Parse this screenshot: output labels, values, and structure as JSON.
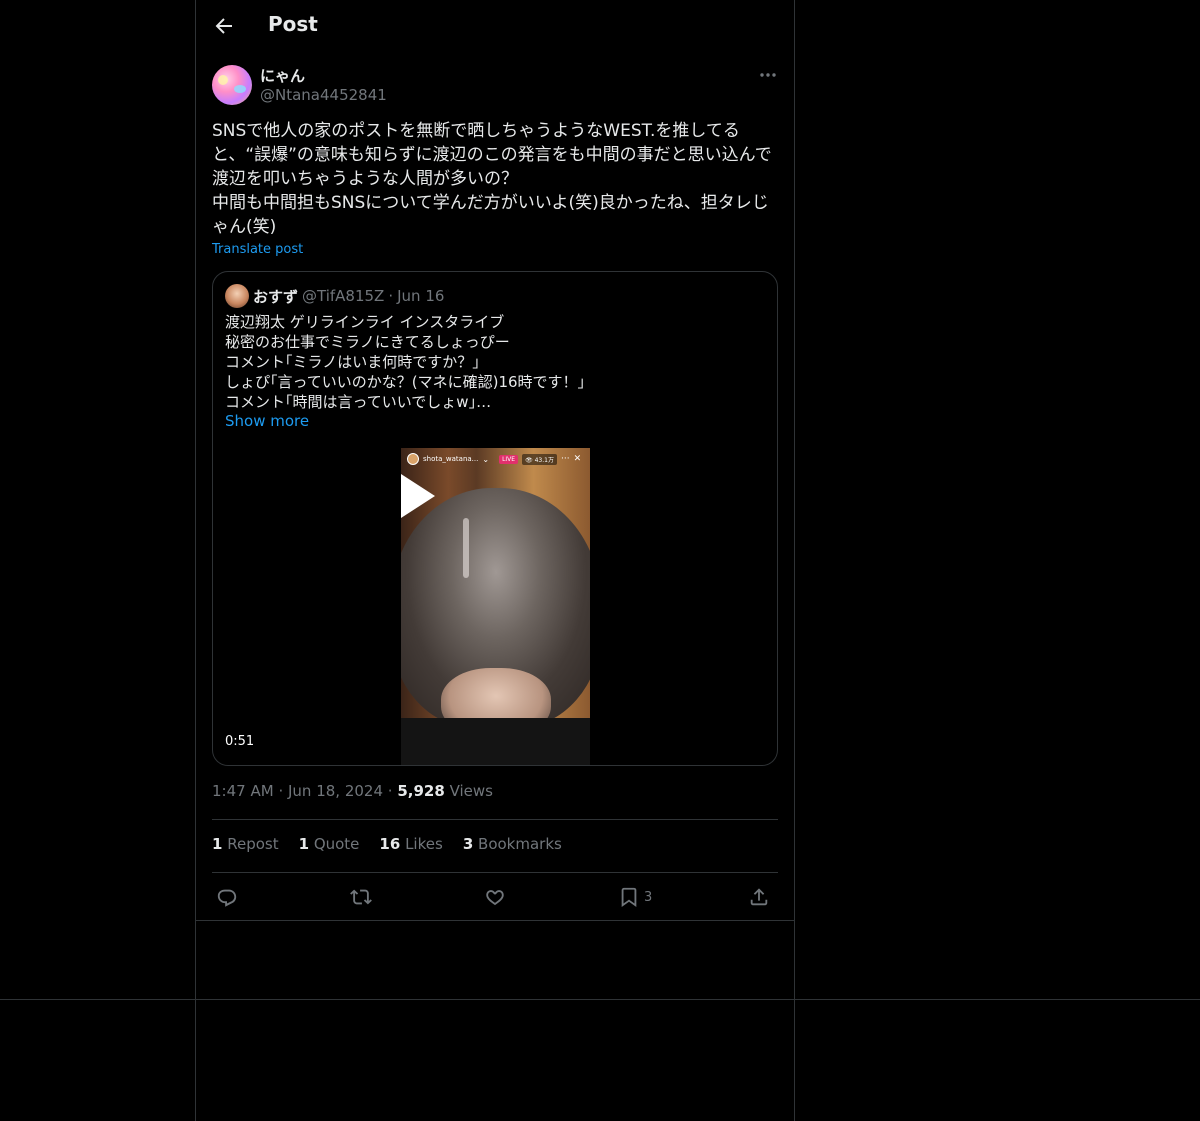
{
  "header": {
    "title": "Post"
  },
  "post": {
    "author_name": "にゃん",
    "author_handle": "@Ntana4452841",
    "text": "SNSで他人の家のポストを無断で晒しちゃうようなWEST.を推してる\nと、“誤爆”の意味も知らずに渡辺のこの発言をも中間の事だと思い込んで\n渡辺を叩いちゃうような人間が多いの？\n中間も中間担もSNSについて学んだ方がいいよ(笑)良かったね、担タレじ\nゃん(笑)",
    "translate_label": "Translate post",
    "time": "1:47 AM",
    "date": "Jun 18, 2024",
    "views_count": "5,928",
    "views_label": "Views"
  },
  "quote": {
    "name": "おすず",
    "handle": "@TifA815Z",
    "separator": "·",
    "date": "Jun 16",
    "text": "渡辺翔太 ゲリラインライ インスタライブ\n秘密のお仕事でミラノにきてるしょっぴー\nコメント｢ミラノはいま何時ですか？｣\nしょぴ｢言っていいのかな？(マネに確認)16時です！｣\nコメント｢時間は言っていいでしょw｣…",
    "show_more": "Show more",
    "video": {
      "duration": "0:51",
      "ig_name": "shota_watana...",
      "live_badge": "LIVE",
      "viewers": "👁 43.1万"
    }
  },
  "stats": {
    "reposts_count": "1",
    "reposts_label": "Repost",
    "quotes_count": "1",
    "quotes_label": "Quote",
    "likes_count": "16",
    "likes_label": "Likes",
    "bookmarks_count": "3",
    "bookmarks_label": "Bookmarks"
  },
  "actions": {
    "bookmark_count": "3",
    "icons": [
      "reply-icon",
      "repost-icon",
      "like-icon",
      "bookmark-icon",
      "share-icon"
    ]
  },
  "colors": {
    "background": "#000000",
    "accent": "#1d9bf0",
    "muted": "#71767b",
    "border": "#2f3336"
  }
}
